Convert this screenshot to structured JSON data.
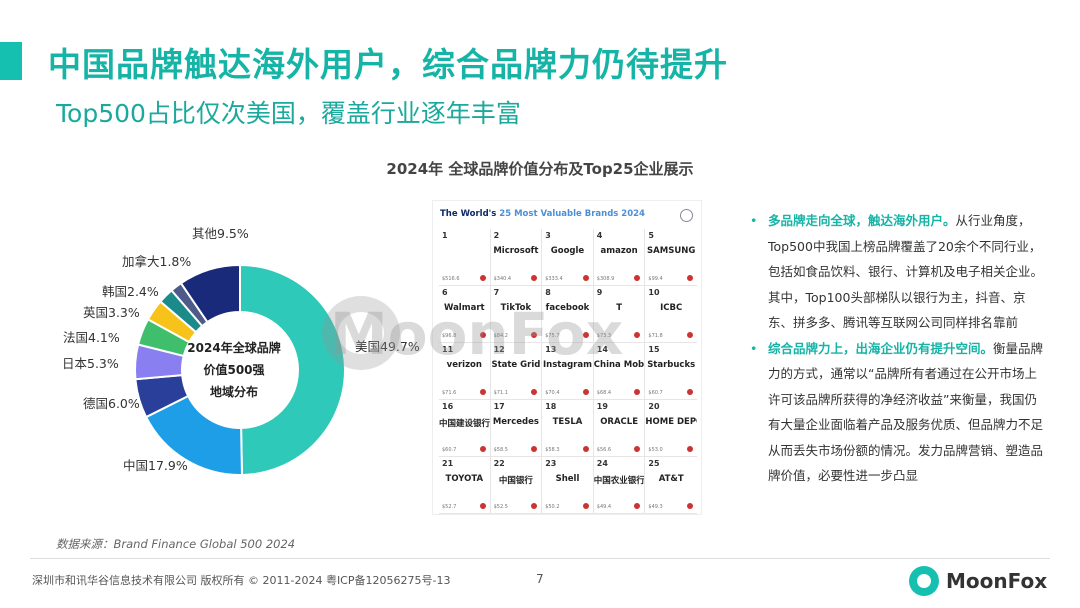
{
  "header": {
    "title": "中国品牌触达海外用户，综合品牌力仍待提升",
    "subtitle": "Top500占比仅次美国，覆盖行业逐年丰富"
  },
  "chart_title": "2024年 全球品牌价值分布及Top25企业展示",
  "chart_data": {
    "type": "pie",
    "title": "2024年 全球品牌价值分布及Top25企业展示",
    "center_label": [
      "2024年全球品牌",
      "价值500强",
      "地域分布"
    ],
    "slices": [
      {
        "name": "美国",
        "value": 49.7,
        "label": "美国49.7%",
        "color": "#2ec9b9"
      },
      {
        "name": "中国",
        "value": 17.9,
        "label": "中国17.9%",
        "color": "#1f9ee8"
      },
      {
        "name": "德国",
        "value": 6.0,
        "label": "德国6.0%",
        "color": "#2a3f9a"
      },
      {
        "name": "日本",
        "value": 5.3,
        "label": "日本5.3%",
        "color": "#8a7ff0"
      },
      {
        "name": "法国",
        "value": 4.1,
        "label": "法国4.1%",
        "color": "#3fbf6b"
      },
      {
        "name": "英国",
        "value": 3.3,
        "label": "英国3.3%",
        "color": "#f7c21a"
      },
      {
        "name": "韩国",
        "value": 2.4,
        "label": "韩国2.4%",
        "color": "#1b8a8a"
      },
      {
        "name": "加拿大",
        "value": 1.8,
        "label": "加拿大1.8%",
        "color": "#4d5b8a"
      },
      {
        "name": "其他",
        "value": 9.5,
        "label": "其他9.5%",
        "color": "#1a2a7a"
      }
    ]
  },
  "brands_panel": {
    "title_prefix": "The World's ",
    "title_highlight": "25 Most Valuable Brands 2024",
    "brands": [
      {
        "rank": "1",
        "name": "",
        "value": "$516.6"
      },
      {
        "rank": "2",
        "name": "Microsoft",
        "value": "$340.4"
      },
      {
        "rank": "3",
        "name": "Google",
        "value": "$333.4"
      },
      {
        "rank": "4",
        "name": "amazon",
        "value": "$308.9"
      },
      {
        "rank": "5",
        "name": "SAMSUNG",
        "value": "$99.4"
      },
      {
        "rank": "6",
        "name": "Walmart",
        "value": "$96.8"
      },
      {
        "rank": "7",
        "name": "TikTok",
        "value": "$84.2"
      },
      {
        "rank": "8",
        "name": "facebook",
        "value": "$75.7"
      },
      {
        "rank": "9",
        "name": "T",
        "value": "$73.3"
      },
      {
        "rank": "10",
        "name": "ICBC",
        "value": "$71.8"
      },
      {
        "rank": "11",
        "name": "verizon",
        "value": "$71.6"
      },
      {
        "rank": "12",
        "name": "State Grid",
        "value": "$71.1"
      },
      {
        "rank": "13",
        "name": "Instagram",
        "value": "$70.4"
      },
      {
        "rank": "14",
        "name": "China Mobile",
        "value": "$68.4"
      },
      {
        "rank": "15",
        "name": "Starbucks",
        "value": "$60.7"
      },
      {
        "rank": "16",
        "name": "中国建设银行",
        "value": "$60.7"
      },
      {
        "rank": "17",
        "name": "Mercedes",
        "value": "$58.5"
      },
      {
        "rank": "18",
        "name": "TESLA",
        "value": "$58.3"
      },
      {
        "rank": "19",
        "name": "ORACLE",
        "value": "$56.6"
      },
      {
        "rank": "20",
        "name": "HOME DEPOT",
        "value": "$53.0"
      },
      {
        "rank": "21",
        "name": "TOYOTA",
        "value": "$52.7"
      },
      {
        "rank": "22",
        "name": "中国银行",
        "value": "$52.5"
      },
      {
        "rank": "23",
        "name": "Shell",
        "value": "$50.2"
      },
      {
        "rank": "24",
        "name": "中国农业银行",
        "value": "$49.4"
      },
      {
        "rank": "25",
        "name": "AT&T",
        "value": "$49.3"
      }
    ]
  },
  "watermark": "MoonFox",
  "bullets": [
    {
      "lead": "多品牌走向全球，触达海外用户。",
      "text": "从行业角度，Top500中我国上榜品牌覆盖了20余个不同行业，包括如食品饮料、银行、计算机及电子相关企业。其中，Top100头部梯队以银行为主，抖音、京东、拼多多、腾讯等互联网公司同样排名靠前"
    },
    {
      "lead": "综合品牌力上，出海企业仍有提升空间。",
      "text": "衡量品牌力的方式，通常以“品牌所有者通过在公开市场上许可该品牌所获得的净经济收益”来衡量，我国仍有大量企业面临着产品及服务优质、但品牌力不足从而丢失市场份额的情况。发力品牌营销、塑造品牌价值，必要性进一步凸显"
    }
  ],
  "source": "数据来源：Brand Finance Global 500 2024",
  "footer": {
    "copyright": "深圳市和讯华谷信息技术有限公司 版权所有 © 2011-2024 粤ICP备12056275号-13",
    "page": "7",
    "brand": "MoonFox"
  }
}
